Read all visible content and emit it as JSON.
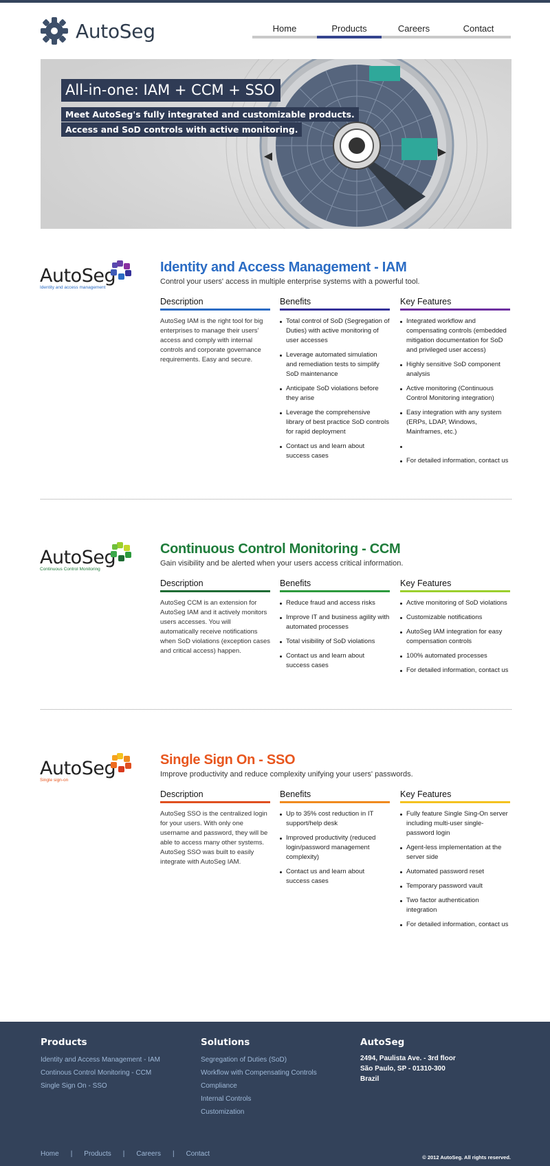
{
  "brand": {
    "name": "AutoSeg"
  },
  "nav": [
    {
      "label": "Home"
    },
    {
      "label": "Products",
      "active": true
    },
    {
      "label": "Careers"
    },
    {
      "label": "Contact"
    }
  ],
  "hero": {
    "title": "All-in-one: IAM + CCM + SSO",
    "line1": "Meet AutoSeg's fully integrated and customizable products.",
    "line2": "Access and SoD controls with active monitoring."
  },
  "products": [
    {
      "logo_word": "AutoSeg",
      "logo_sub": "Identity and access management",
      "title": "Identity and Access Management - IAM",
      "subtitle": "Control your users' access in multiple enterprise systems with a powerful tool.",
      "color": "#2b6cc4",
      "col_colors": [
        "#2b6cc4",
        "#35319a",
        "#6e2fa0"
      ],
      "description_heading": "Description",
      "description": "AutoSeg IAM is the right tool for big enterprises to manage their users' access and comply with internal controls and corporate governance requirements. Easy and secure.",
      "benefits_heading": "Benefits",
      "benefits": [
        "Total control of SoD (Segregation of Duties) with active monitoring of user accesses",
        "Leverage automated simulation and remediation tests to simplify SoD maintenance",
        "Anticipate SoD violations before they arise",
        "Leverage the comprehensive library of best practice SoD controls for rapid deployment",
        "Contact us and learn about success cases"
      ],
      "features_heading": "Key Features",
      "features": [
        "Integrated workflow and compensating controls (embedded mitigation documentation for SoD and privileged user access)",
        "Highly sensitive SoD component analysis",
        "Active monitoring (Continuous Control Monitoring integration)",
        "Easy integration with any system (ERPs, LDAP, Windows, Mainframes, etc.)",
        "",
        "For detailed information, contact us"
      ]
    },
    {
      "logo_word": "AutoSeg",
      "logo_sub": "Continuous Control Monitoring",
      "title": "Continuous Control Monitoring - CCM",
      "subtitle": "Gain visibility and be alerted when your users access critical information.",
      "color": "#1e7c3a",
      "col_colors": [
        "#1e6b33",
        "#2c9a3c",
        "#9bcf2c"
      ],
      "description_heading": "Description",
      "description": "AutoSeg CCM is an extension for AutoSeg IAM and it actively monitors users accesses. You will automatically receive notifications when SoD violations (exception cases and critical access) happen.",
      "benefits_heading": "Benefits",
      "benefits": [
        "Reduce fraud and access risks",
        "Improve IT and business agility with automated processes",
        "Total visibility of SoD violations",
        "Contact us and learn about success cases"
      ],
      "features_heading": "Key Features",
      "features": [
        "Active monitoring of SoD violations",
        "Customizable notifications",
        "AutoSeg IAM integration for easy compensation controls",
        "100% automated processes",
        "For detailed information, contact us"
      ]
    },
    {
      "logo_word": "AutoSeg",
      "logo_sub": "Single sign-on",
      "title": "Single Sign On - SSO",
      "subtitle": "Improve productivity and reduce complexity unifying your users' passwords.",
      "color": "#e8561e",
      "col_colors": [
        "#e04f1f",
        "#f08a1e",
        "#f4c21f"
      ],
      "description_heading": "Description",
      "description": "AutoSeg SSO is the centralized login for your users. With only one username and password, they will be able to access many other systems. AutoSeg SSO was built to easily integrate with AutoSeg IAM.",
      "benefits_heading": "Benefits",
      "benefits": [
        "Up to 35% cost reduction in IT support/help desk",
        "Improved productivity (reduced login/password management complexity)",
        "Contact us and learn about success cases"
      ],
      "features_heading": "Key Features",
      "features": [
        "Fully feature Single Sing-On server including multi-user single-password login",
        "Agent-less implementation at the server side",
        "Automated password reset",
        "Temporary password vault",
        "Two factor authentication integration",
        "For detailed information, contact us"
      ]
    }
  ],
  "footer": {
    "products_heading": "Products",
    "products_links": [
      "Identity and Access Management - IAM",
      "Continous Control Monitoring - CCM",
      "Single Sign On - SSO"
    ],
    "solutions_heading": "Solutions",
    "solutions_links": [
      "Segregation of Duties (SoD)",
      "Workflow with Compensating Controls",
      "Compliance",
      "Internal Controls",
      "Customization"
    ],
    "company_heading": "AutoSeg",
    "address": [
      "2494, Paulista Ave. - 3rd floor",
      "São Paulo, SP - 01310-300",
      "Brazil"
    ],
    "nav": [
      "Home",
      "Products",
      "Careers",
      "Contact"
    ],
    "copyright": "© 2012 AutoSeg. All rights reserved."
  }
}
